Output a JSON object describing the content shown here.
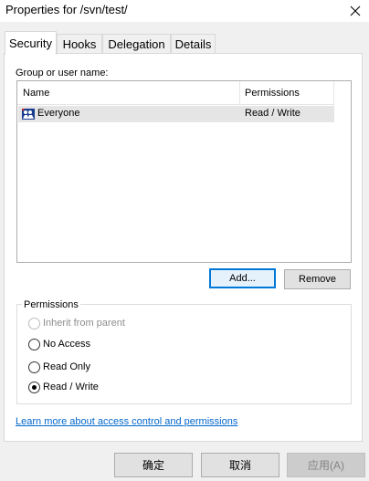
{
  "window": {
    "title": "Properties for /svn/test/"
  },
  "tabs": [
    {
      "label": "Security",
      "active": true
    },
    {
      "label": "Hooks",
      "active": false
    },
    {
      "label": "Delegation",
      "active": false
    },
    {
      "label": "Details",
      "active": false
    }
  ],
  "security": {
    "group_label": "Group or user name:",
    "list": {
      "columns": [
        "Name",
        "Permissions"
      ],
      "rows": [
        {
          "name": "Everyone",
          "permission": "Read / Write",
          "icon": "users-group-icon"
        }
      ]
    },
    "add_label": "Add...",
    "remove_label": "Remove",
    "permissions": {
      "title": "Permissions",
      "options": [
        {
          "label": "Inherit from parent",
          "checked": false,
          "enabled": false
        },
        {
          "label": "No Access",
          "checked": false,
          "enabled": true
        },
        {
          "label": "Read Only",
          "checked": false,
          "enabled": true
        },
        {
          "label": "Read / Write",
          "checked": true,
          "enabled": true
        }
      ]
    },
    "learn_more": "Learn more about access control and permissions"
  },
  "footer": {
    "ok": "确定",
    "cancel": "取消",
    "apply": "应用(A)"
  },
  "colors": {
    "accent": "#0078d7",
    "link": "#0066cc",
    "row_selected": "#e5e5e5"
  }
}
